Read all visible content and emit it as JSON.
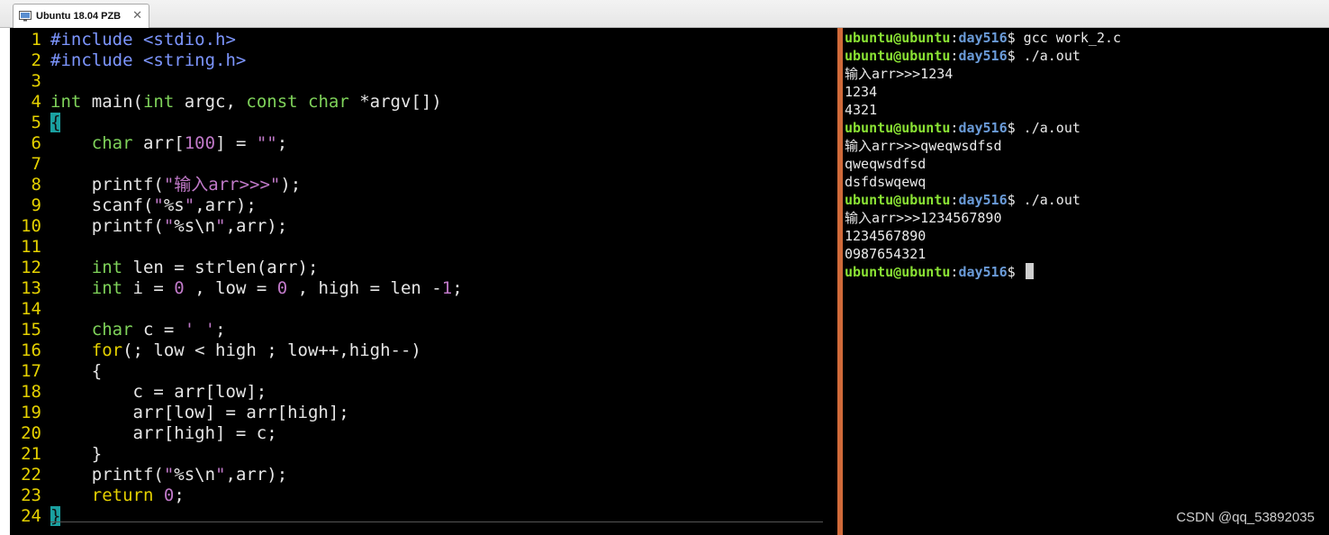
{
  "tabbar": {
    "tab_title": "Ubuntu 18.04 PZB",
    "close_glyph": "✕"
  },
  "editor": {
    "lines": [
      {
        "n": "1",
        "parts": [
          [
            "pp",
            "#include <stdio.h>"
          ]
        ]
      },
      {
        "n": "2",
        "parts": [
          [
            "pp",
            "#include <string.h>"
          ]
        ]
      },
      {
        "n": "3",
        "parts": []
      },
      {
        "n": "4",
        "parts": [
          [
            "ty",
            "int"
          ],
          [
            "",
            " main("
          ],
          [
            "ty",
            "int"
          ],
          [
            "",
            " argc, "
          ],
          [
            "ty",
            "const"
          ],
          [
            "",
            " "
          ],
          [
            "ty",
            "char"
          ],
          [
            "",
            " *argv[])"
          ]
        ]
      },
      {
        "n": "5",
        "parts": [
          [
            "cur",
            "{"
          ]
        ]
      },
      {
        "n": "6",
        "parts": [
          [
            "",
            "    "
          ],
          [
            "ty",
            "char"
          ],
          [
            "",
            " arr["
          ],
          [
            "st",
            "100"
          ],
          [
            "",
            "] = "
          ],
          [
            "st",
            "\"\""
          ],
          [
            "",
            ";"
          ]
        ]
      },
      {
        "n": "7",
        "parts": []
      },
      {
        "n": "8",
        "parts": [
          [
            "",
            "    printf("
          ],
          [
            "st",
            "\"输入arr>>>\""
          ],
          [
            "",
            ");"
          ]
        ]
      },
      {
        "n": "9",
        "parts": [
          [
            "",
            "    scanf("
          ],
          [
            "st",
            "\""
          ],
          [
            "",
            "%s"
          ],
          [
            "st",
            "\""
          ],
          [
            "",
            ",arr);"
          ]
        ]
      },
      {
        "n": "10",
        "parts": [
          [
            "",
            "    printf("
          ],
          [
            "st",
            "\""
          ],
          [
            "",
            "%s\\n"
          ],
          [
            "st",
            "\""
          ],
          [
            "",
            ",arr);"
          ]
        ]
      },
      {
        "n": "11",
        "parts": []
      },
      {
        "n": "12",
        "parts": [
          [
            "",
            "    "
          ],
          [
            "ty",
            "int"
          ],
          [
            "",
            " len = strlen(arr);"
          ]
        ]
      },
      {
        "n": "13",
        "parts": [
          [
            "",
            "    "
          ],
          [
            "ty",
            "int"
          ],
          [
            "",
            " i = "
          ],
          [
            "st",
            "0"
          ],
          [
            "",
            " , low = "
          ],
          [
            "st",
            "0"
          ],
          [
            "",
            " , high = len -"
          ],
          [
            "st",
            "1"
          ],
          [
            "",
            ";"
          ]
        ]
      },
      {
        "n": "14",
        "parts": []
      },
      {
        "n": "15",
        "parts": [
          [
            "",
            "    "
          ],
          [
            "ty",
            "char"
          ],
          [
            "",
            " c = "
          ],
          [
            "st",
            "' '"
          ],
          [
            "",
            ";"
          ]
        ]
      },
      {
        "n": "16",
        "parts": [
          [
            "",
            "    "
          ],
          [
            "kw",
            "for"
          ],
          [
            "",
            "(; low < high ; low++,high--)"
          ]
        ]
      },
      {
        "n": "17",
        "parts": [
          [
            "",
            "    {"
          ]
        ]
      },
      {
        "n": "18",
        "parts": [
          [
            "",
            "        c = arr[low];"
          ]
        ]
      },
      {
        "n": "19",
        "parts": [
          [
            "",
            "        arr[low] = arr[high];"
          ]
        ]
      },
      {
        "n": "20",
        "parts": [
          [
            "",
            "        arr[high] = c;"
          ]
        ]
      },
      {
        "n": "21",
        "parts": [
          [
            "",
            "    }"
          ]
        ]
      },
      {
        "n": "22",
        "parts": [
          [
            "",
            "    printf("
          ],
          [
            "st",
            "\""
          ],
          [
            "",
            "%s\\n"
          ],
          [
            "st",
            "\""
          ],
          [
            "",
            ",arr);"
          ]
        ]
      },
      {
        "n": "23",
        "parts": [
          [
            "",
            "    "
          ],
          [
            "kw",
            "return"
          ],
          [
            "",
            " "
          ],
          [
            "st",
            "0"
          ],
          [
            "",
            ";"
          ]
        ]
      },
      {
        "n": "24",
        "parts": [
          [
            "cur",
            "}"
          ]
        ]
      }
    ]
  },
  "terminal": {
    "prompt_user": "ubuntu@ubuntu",
    "prompt_colon": ":",
    "prompt_path": "day516",
    "prompt_dollar": "$",
    "lines": [
      {
        "type": "prompt",
        "cmd": " gcc work_2.c"
      },
      {
        "type": "prompt",
        "cmd": " ./a.out"
      },
      {
        "type": "out",
        "text": "输入arr>>>1234"
      },
      {
        "type": "out",
        "text": "1234"
      },
      {
        "type": "out",
        "text": "4321"
      },
      {
        "type": "prompt",
        "cmd": " ./a.out"
      },
      {
        "type": "out",
        "text": "输入arr>>>qweqwsdfsd"
      },
      {
        "type": "out",
        "text": "qweqwsdfsd"
      },
      {
        "type": "out",
        "text": "dsfdswqewq"
      },
      {
        "type": "prompt",
        "cmd": " ./a.out"
      },
      {
        "type": "out",
        "text": "输入arr>>>1234567890"
      },
      {
        "type": "out",
        "text": "1234567890"
      },
      {
        "type": "out",
        "text": "0987654321"
      },
      {
        "type": "prompt",
        "cmd": " ",
        "cursor": true
      }
    ]
  },
  "watermark": "CSDN @qq_53892035"
}
